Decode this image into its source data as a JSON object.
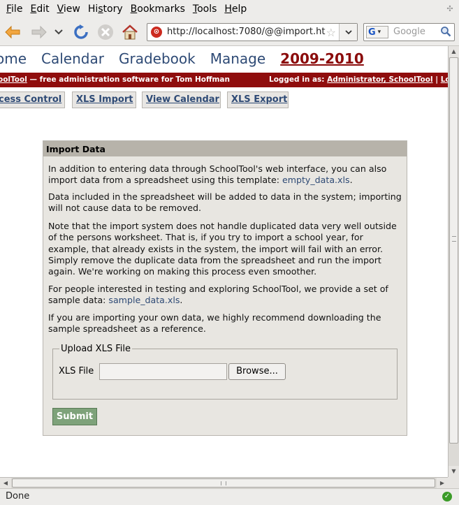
{
  "menubar": {
    "items": [
      "File",
      "Edit",
      "View",
      "History",
      "Bookmarks",
      "Tools",
      "Help"
    ]
  },
  "toolbar": {
    "url": "http://localhost:7080/@@import.ht",
    "search_placeholder": "Google",
    "search_engine": "G"
  },
  "status": {
    "text": "Done"
  },
  "page": {
    "topnav": {
      "home": "ome",
      "calendar": "Calendar",
      "gradebook": "Gradebook",
      "manage": "Manage",
      "year": "2009-2010"
    },
    "redbar": {
      "brand": "oolTool",
      "tagline": " — free administration software for Tom Hoffman",
      "logged_prefix": "Logged in as: ",
      "user": "Administrator, SchoolTool",
      "sep": " | ",
      "logout": "Log"
    },
    "subnav": {
      "access": "cess Control",
      "xls_import": "XLS Import",
      "view_calendar": "View Calendar",
      "xls_export": "XLS Export"
    },
    "panel": {
      "title": "Import Data",
      "p1_text": "In addition to entering data through SchoolTool's web interface, you can also import data from a spreadsheet using this template: ",
      "p1_link": "empty_data.xls",
      "p1_end": ".",
      "p2": "Data included in the spreadsheet will be added to data in the system; importing will not cause data to be removed.",
      "p3": "Note that the import system does not handle duplicated data very well outside of the persons worksheet. That is, if you try to import a school year, for example, that already exists in the system, the import will fail with an error. Simply remove the duplicate data from the spreadsheet and run the import again. We're working on making this process even smoother.",
      "p4_text": "For people interested in testing and exploring SchoolTool, we provide a set of sample data: ",
      "p4_link": "sample_data.xls",
      "p4_end": ".",
      "p5": "If you are importing your own data, we highly recommend downloading the sample spreadsheet as a reference.",
      "fieldset_legend": "Upload XLS File",
      "file_label": "XLS File",
      "browse_label": "Browse...",
      "submit_label": "Submit"
    }
  },
  "colors": {
    "nav_link": "#2e4a75",
    "year_link": "#8b0c0c",
    "redbar": "#8f0d0d",
    "submit_bg": "#7ea27a",
    "panel_header": "#b7b3aa"
  }
}
